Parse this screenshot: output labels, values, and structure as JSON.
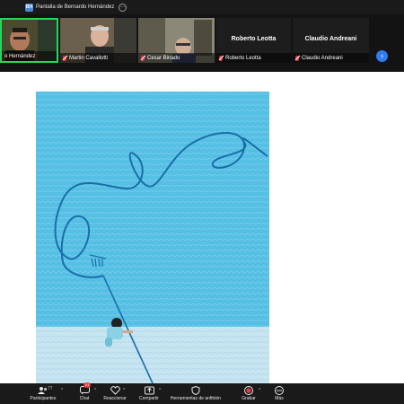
{
  "share_bar": {
    "badge": "BH",
    "title": "Pantalla de Bernardo Hernández"
  },
  "gallery": {
    "participants": [
      {
        "name": "o Hernández",
        "muted": false,
        "video": true
      },
      {
        "name": "Martin Cavallotti",
        "muted": true,
        "video": true
      },
      {
        "name": "Cesar Binado",
        "muted": true,
        "video": true
      },
      {
        "name": "Roberto Leotta",
        "muted": true,
        "video": false,
        "display_name": "Roberto Leotta"
      },
      {
        "name": "Claudio Andreani",
        "muted": true,
        "video": false,
        "display_name": "Claudio Andreani"
      }
    ],
    "next_icon": "chevron-right-icon"
  },
  "toolbar": {
    "participants_label": "Participantes",
    "participants_count": "77",
    "chat_label": "Chat",
    "chat_badge": "21",
    "react_label": "Reaccionar",
    "share_label": "Compartir",
    "host_tools_label": "Herramientas de anfitrión",
    "record_label": "Grabar",
    "more_label": "Más",
    "record_color": "#e0393e"
  },
  "colors": {
    "pool": "#56bfe4",
    "pool_light": "#c5e3f0",
    "hose": "#1a6ea8",
    "active_speaker": "#23d95b",
    "accent": "#2f7bf0"
  }
}
